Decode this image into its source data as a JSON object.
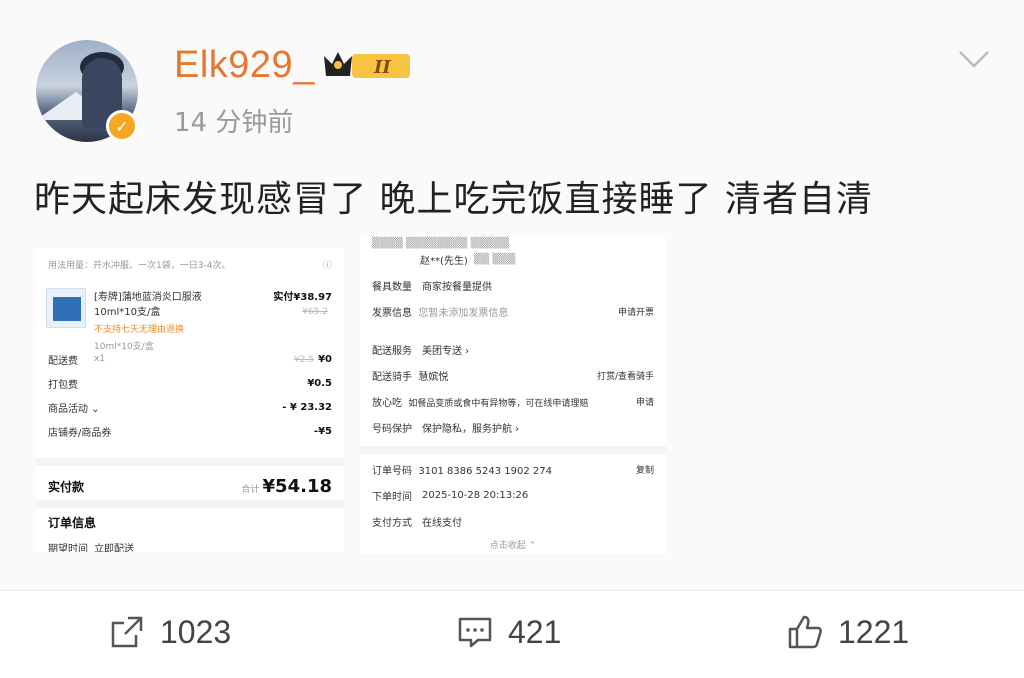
{
  "post": {
    "username": "Elk929_",
    "badge_level": "II",
    "timestamp": "14 分钟前",
    "text": "昨天起床发现感冒了 晚上吃完饭直接睡了  清者自清"
  },
  "order_left": {
    "usage": "用法用量：开水冲服。一次1袋，一日3-4次。",
    "product_name": "[寿牌]蒲地蓝消炎口服液 10ml*10支/盒",
    "paid_label": "实付¥38.97",
    "original_price": "¥65.2",
    "return_note": "不支持七天无理由退换",
    "spec": "10ml*10支/盒",
    "qty": "x1",
    "delivery_label": "配送费",
    "delivery_old": "¥2.5",
    "delivery_val": "¥0",
    "packing_label": "打包费",
    "packing_val": "¥0.5",
    "promo_label": "商品活动",
    "promo_val": "- ¥ 23.32",
    "coupon_label": "店铺券/商品券",
    "coupon_val": "-¥5",
    "total_label": "实付款",
    "total_prefix": "合计",
    "total_val": "¥54.18",
    "info_title": "订单信息",
    "expect_label": "期望时间",
    "expect_val": "立即配送"
  },
  "order_right": {
    "addr_name": "赵**(先生)",
    "tableware_label": "餐具数量",
    "tableware_val": "商家按餐量提供",
    "invoice_label": "发票信息",
    "invoice_val": "您暂未添加发票信息",
    "invoice_action": "申请开票",
    "service_label": "配送服务",
    "service_val": "美团专送 ›",
    "rider_label": "配送骑手",
    "rider_val": "慧嫔悦",
    "rider_action": "打赏/查看骑手",
    "safe_label": "放心吃",
    "safe_val": "如餐品变质或食中有异物等，可在线申请理赔",
    "safe_action": "申请",
    "privacy_label": "号码保护",
    "privacy_val": "保护隐私，服务护航 ›",
    "order_no_label": "订单号码",
    "order_no_val": "3101 8386 5243 1902 274",
    "copy_label": "复制",
    "time_label": "下单时间",
    "time_val": "2025-10-28 20:13:26",
    "pay_label": "支付方式",
    "pay_val": "在线支付",
    "collapse": "点击收起 ⌃"
  },
  "actions": {
    "share_count": "1023",
    "comment_count": "421",
    "like_count": "1221"
  },
  "colors": {
    "username": "#e8772e",
    "accent_red": "#e4393c",
    "verified": "#f6a623"
  },
  "icons": [
    "chevron-down-icon",
    "crown-badge-icon",
    "verified-icon",
    "share-icon",
    "comment-icon",
    "like-icon"
  ]
}
